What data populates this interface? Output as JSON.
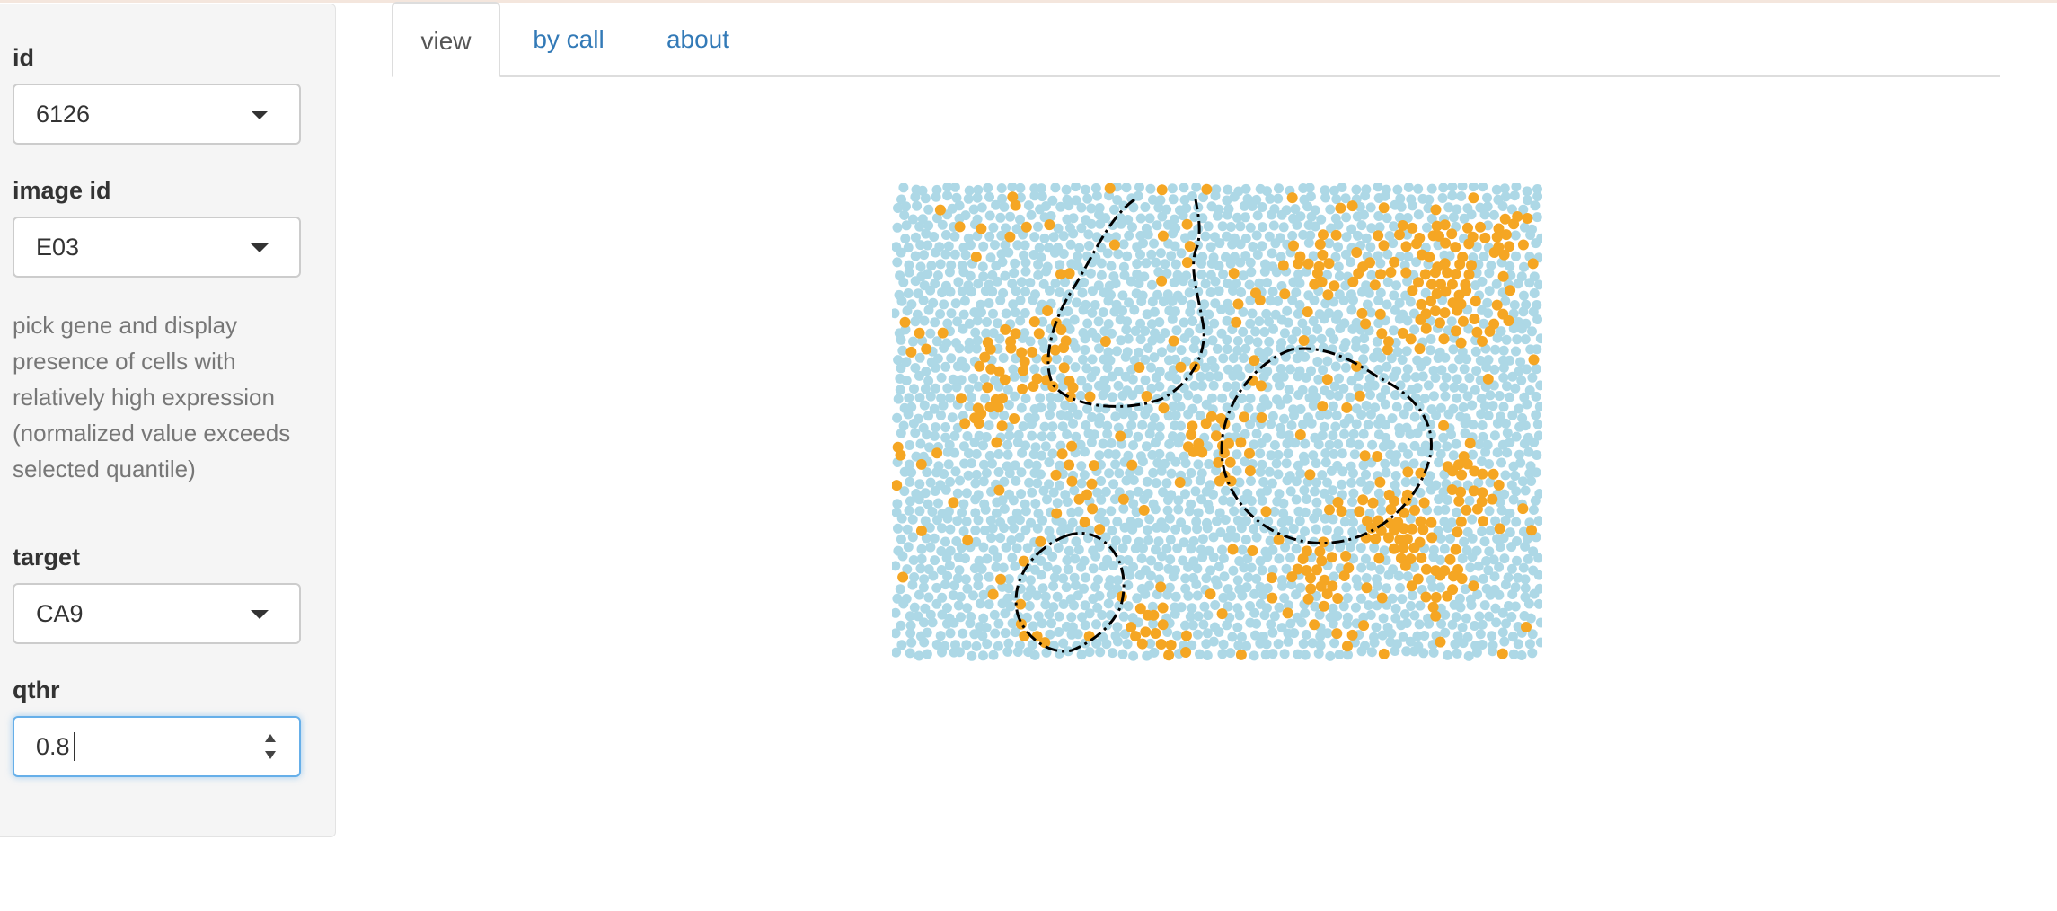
{
  "sidebar": {
    "id_label": "id",
    "id_value": "6126",
    "image_id_label": "image id",
    "image_id_value": "E03",
    "help_text": "pick gene and display presence of cells with relatively high expression (normalized value exceeds selected quantile)",
    "target_label": "target",
    "target_value": "CA9",
    "qthr_label": "qthr",
    "qthr_value": "0.8"
  },
  "tabs": [
    {
      "label": "view",
      "active": true
    },
    {
      "label": "by call",
      "active": false
    },
    {
      "label": "about",
      "active": false
    }
  ],
  "plot": {
    "kind": "cell spatial scatter",
    "colors": {
      "background_cell": "#add8e6",
      "high_expression_cell": "#f5a623",
      "boundary": "#000000"
    },
    "boundary_style": "dash-dot"
  }
}
